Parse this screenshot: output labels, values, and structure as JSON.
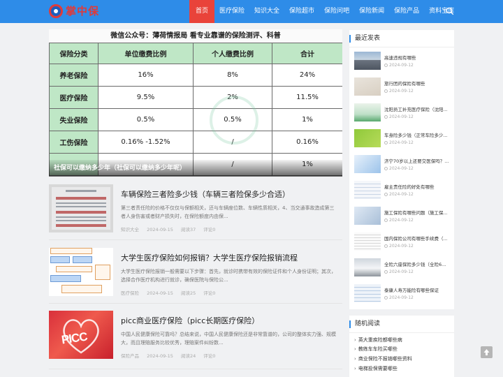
{
  "site": {
    "logo_text": "掌中保",
    "colors": {
      "header": "#2e8ce8",
      "active_nav": "#e9433a"
    }
  },
  "nav": {
    "items": [
      {
        "label": "首页",
        "active": true
      },
      {
        "label": "医疗保险"
      },
      {
        "label": "知识大全"
      },
      {
        "label": "保险超市"
      },
      {
        "label": "保险问吧"
      },
      {
        "label": "保险新闻"
      },
      {
        "label": "保险产品"
      },
      {
        "label": "资料宝库"
      }
    ],
    "search_icon": "search-icon"
  },
  "hero": {
    "header_text": "微信公众号：薄荷情报局  看专业靠谱的保险测评、科普",
    "table_header": [
      "保险分类",
      "单位缴费比例",
      "个人缴费比例",
      "合计"
    ],
    "rows": [
      [
        "养老保险",
        "16%",
        "8%",
        "24%"
      ],
      [
        "医疗保险",
        "9.5%",
        "2%",
        "11.5%"
      ],
      [
        "失业保险",
        "0.5%",
        "0.5%",
        "1%"
      ],
      [
        "工伤保险",
        "0.16% -1.52%",
        "/",
        "0.16%"
      ],
      [
        "",
        "",
        "/",
        "1%"
      ]
    ],
    "caption": "社保可以缴纳多少年（社保可以缴纳多少年呢）"
  },
  "articles": [
    {
      "title": "车辆保险三者险多少钱（车辆三者险保多少合适）",
      "excerpt": "第三者责任险的价格不仅仅与保额相关，还与车辆座位数、车辆性质相关，4、当交通事故造成第三者人身伤害或者财产损失时，在保险额度内由保...",
      "category": "知识大全",
      "date": "2024-09-15",
      "reads": "阅读37",
      "comments": "评论0"
    },
    {
      "title": "大学生医疗保险如何报销？大学生医疗保险报销流程",
      "excerpt": "大学生医疗保险报销一般需要以下步骤：首先，就诊时携带有效的保险证件和个人身份证明；其次，选择合作医疗机构进行就诊，确保医院与保险公...",
      "category": "医疗保险",
      "date": "2024-09-15",
      "reads": "阅读25",
      "comments": "评论0"
    },
    {
      "title": "picc商业医疗保险（picc长期医疗保险）",
      "excerpt": "中国人民健康保险可靠吗？总结来说，中国人民健康保险还是非常靠谱的，公司的整体实力强、规模大，而且理赔服务比较优秀，理赔案件纠纷数...",
      "category": "保险产品",
      "date": "2024-09-15",
      "reads": "阅读24",
      "comments": "评论0",
      "thumb_text": "PICC"
    }
  ],
  "sidebar": {
    "recent_title": "最近发表",
    "recent": [
      {
        "title": "高速违规有哪些",
        "date": "2024-09-12"
      },
      {
        "title": "旅行团的保险有哪些",
        "date": "2024-09-12"
      },
      {
        "title": "沈阳员工补充医疗保险（沈阳...",
        "date": "2024-09-12"
      },
      {
        "title": "车身险多少钱（正常车险多少...",
        "date": "2024-09-12"
      },
      {
        "title": "济宁70岁以上还要交医保吗？...",
        "date": "2024-09-12"
      },
      {
        "title": "雇主责任险的好处有哪些",
        "date": "2024-09-12"
      },
      {
        "title": "施工保险有哪些问题（施工保...",
        "date": "2024-09-12"
      },
      {
        "title": "国内保险公司有哪些手续费（...",
        "date": "2024-09-12"
      },
      {
        "title": "全险六座保险多少钱（全险6...",
        "date": "2024-09-12"
      },
      {
        "title": "泰康人寿万能险有哪些保证",
        "date": "2024-09-12"
      }
    ],
    "random_title": "随机阅读",
    "random": [
      {
        "title": "英大重疾险都哪些病"
      },
      {
        "title": "教练车车险买哪些"
      },
      {
        "title": "商业保险不报销哪些资料"
      },
      {
        "title": "电梯投保需要哪些"
      }
    ]
  }
}
